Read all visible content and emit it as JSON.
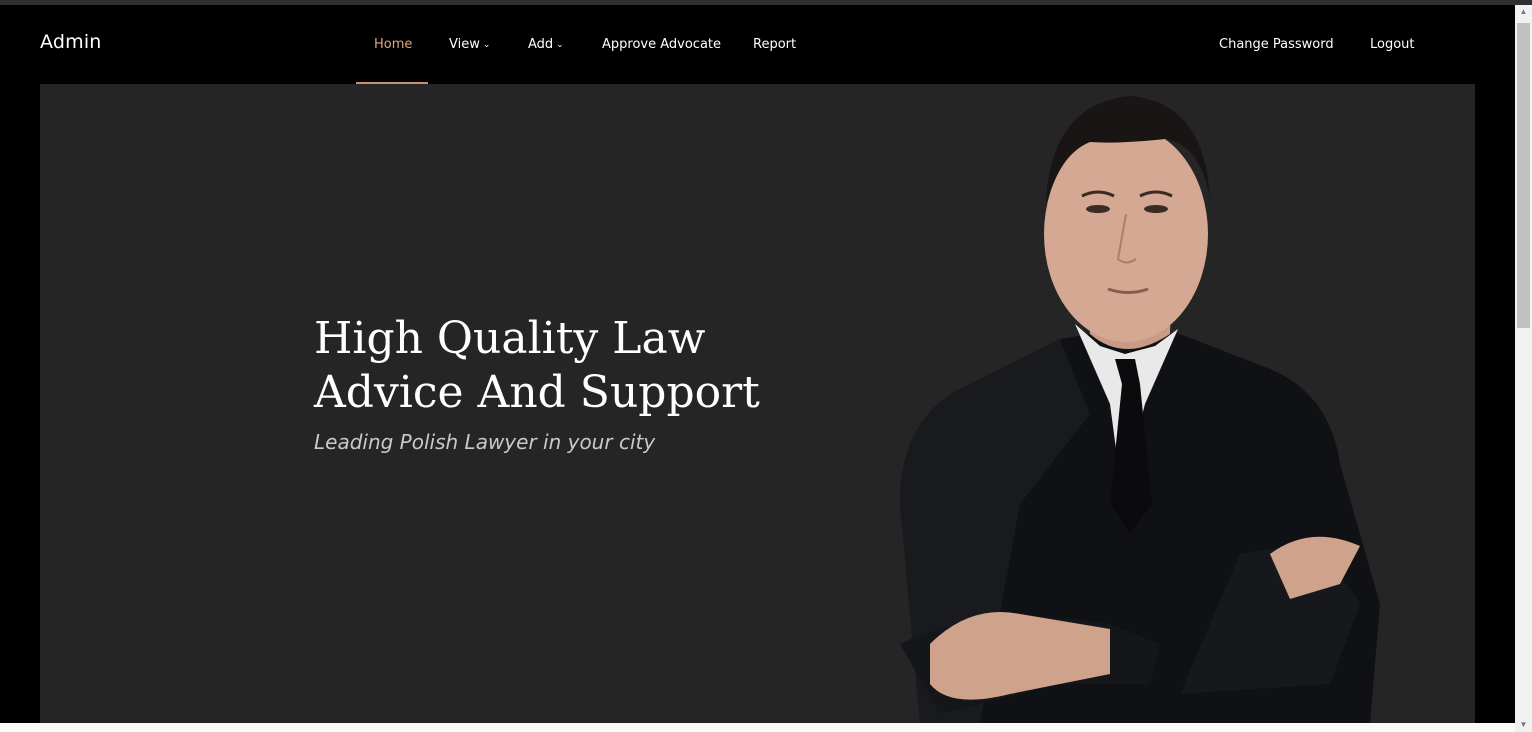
{
  "navbar": {
    "brand": "Admin",
    "items": [
      {
        "label": "Home",
        "active": true
      },
      {
        "label": "View",
        "dropdown": true
      },
      {
        "label": "Add",
        "dropdown": true
      },
      {
        "label": "Approve Advocate"
      },
      {
        "label": "Report"
      }
    ],
    "right_items": [
      {
        "label": "Change Password"
      },
      {
        "label": "Logout"
      }
    ]
  },
  "hero": {
    "title_line1": "High Quality Law",
    "title_line2": "Advice And Support",
    "subtitle": "Leading Polish Lawyer in your city",
    "image": "lawyer-portrait"
  },
  "colors": {
    "accent": "#e3a57b",
    "background": "#000000",
    "hero_bg": "#252525"
  },
  "icons": {
    "dropdown": "chevron-down-icon",
    "scroll_up": "arrow-up-icon",
    "scroll_down": "arrow-down-icon"
  }
}
